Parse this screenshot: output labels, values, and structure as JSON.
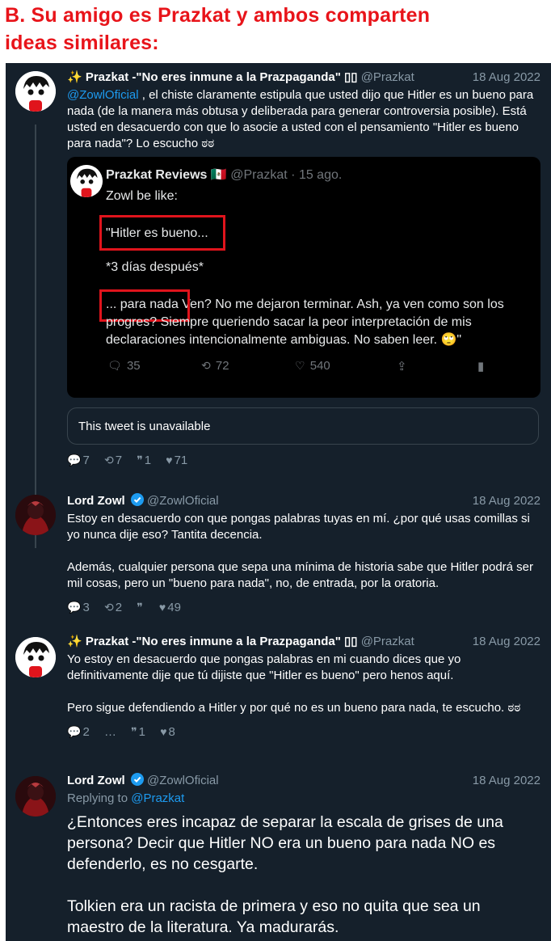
{
  "header": {
    "line1": "B. Su amigo es Prazkat y ambos comparten",
    "line2": "ideas similares:"
  },
  "tweets": [
    {
      "name": "✨ Prazkat -\"No eres inmune a la Prazpaganda\" ▯▯",
      "handle": "@Prazkat",
      "date": "18 Aug 2022",
      "mention": "@ZowlOficial",
      "text": " , el chiste claramente estipula que usted dijo que Hitler es un bueno para nada (de la manera más obtusa y deliberada para generar controversia posible). Está usted en desacuerdo con que lo asocie a usted con el pensamiento \"Hitler es bueno para nada\"? Lo escucho ಠಠ",
      "embed": {
        "name": "Prazkat Reviews",
        "flag": "🇲🇽",
        "handle_time": "@Prazkat · 15 ago.",
        "line1": "Zowl be like:",
        "quote1": "\"Hitler es bueno...",
        "line3": "*3 días después*",
        "quote2": "... para nada",
        "line4": " Ven? No me dejaron terminar. Ash, ya ven como son los",
        "line5": "progres? Siempre queriendo sacar la peor interpretación de mis",
        "line6": "declaraciones intencionalmente ambiguas. No saben leer. 🙄\"",
        "replies": "35",
        "retweets": "72",
        "likes": "540"
      },
      "unavailable": "This tweet is unavailable",
      "replies": "7",
      "retweets": "7",
      "quotes": "1",
      "likes": "71"
    },
    {
      "name": "Lord Zowl",
      "handle": "@ZowlOficial",
      "date": "18 Aug 2022",
      "p1": "Estoy en desacuerdo con que pongas palabras tuyas en mí. ¿por qué usas comillas si yo nunca dije eso? Tantita decencia.",
      "p2": "Además, cualquier persona que sepa una mínima de historia sabe que Hitler podrá ser mil cosas, pero un \"bueno para nada\", no, de entrada, por la oratoria.",
      "replies": "3",
      "retweets": "2",
      "likes": "49"
    },
    {
      "name": "✨ Prazkat -\"No eres inmune a la Prazpaganda\" ▯▯",
      "handle": "@Prazkat",
      "date": "18 Aug 2022",
      "p1": "Yo estoy en desacuerdo que pongas palabras en mi cuando dices que yo definitivamente dije que tú dijiste que \"Hitler es bueno\" pero henos aquí.",
      "p2": "Pero sigue defendiendo a Hitler y por qué no es un bueno para nada, te escucho. ಠಠ",
      "replies": "2",
      "retweets": "…",
      "quotes": "1",
      "likes": "8"
    },
    {
      "name": "Lord Zowl",
      "handle": "@ZowlOficial",
      "date": "18 Aug 2022",
      "replying_label": "Replying to",
      "replying_to": "@Prazkat",
      "p1": "¿Entonces eres incapaz de separar la escala de grises de una persona? Decir que Hitler NO era un bueno para nada NO es defenderlo, es no cesgarte.",
      "p2": "Tolkien era un racista de primera y eso no quita que sea un maestro de la literatura. Ya madurarás."
    }
  ],
  "colors": {
    "header": "#e8141a",
    "panel": "#15202b",
    "link": "#1d9bf0",
    "muted": "#8899a6",
    "redbox": "#e0141c"
  }
}
